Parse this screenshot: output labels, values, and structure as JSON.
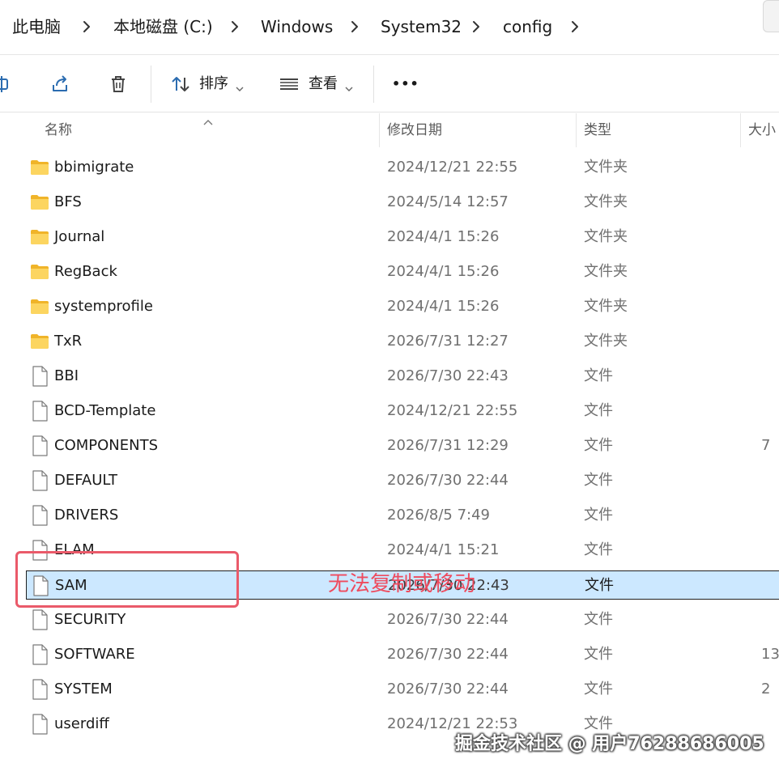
{
  "breadcrumb": {
    "items": [
      "此电脑",
      "本地磁盘 (C:)",
      "Windows",
      "System32",
      "config"
    ]
  },
  "toolbar": {
    "sort_label": "排序",
    "view_label": "查看",
    "more_label": "•••"
  },
  "columns": {
    "name": "名称",
    "modified": "修改日期",
    "type": "类型",
    "size": "大小"
  },
  "files": [
    {
      "name": "bbimigrate",
      "modified": "2024/12/21 22:55",
      "type": "文件夹",
      "size": "",
      "icon": "folder-icon"
    },
    {
      "name": "BFS",
      "modified": "2024/5/14 12:57",
      "type": "文件夹",
      "size": "",
      "icon": "folder-icon"
    },
    {
      "name": "Journal",
      "modified": "2024/4/1 15:26",
      "type": "文件夹",
      "size": "",
      "icon": "folder-icon"
    },
    {
      "name": "RegBack",
      "modified": "2024/4/1 15:26",
      "type": "文件夹",
      "size": "",
      "icon": "folder-icon"
    },
    {
      "name": "systemprofile",
      "modified": "2024/4/1 15:26",
      "type": "文件夹",
      "size": "",
      "icon": "folder-icon"
    },
    {
      "name": "TxR",
      "modified": "2026/7/31 12:27",
      "type": "文件夹",
      "size": "",
      "icon": "folder-icon"
    },
    {
      "name": "BBI",
      "modified": "2026/7/30 22:43",
      "type": "文件",
      "size": "",
      "icon": "file-icon"
    },
    {
      "name": "BCD-Template",
      "modified": "2024/12/21 22:55",
      "type": "文件",
      "size": "",
      "icon": "file-icon"
    },
    {
      "name": "COMPONENTS",
      "modified": "2026/7/31 12:29",
      "type": "文件",
      "size": "7",
      "icon": "file-icon"
    },
    {
      "name": "DEFAULT",
      "modified": "2026/7/30 22:44",
      "type": "文件",
      "size": "",
      "icon": "file-icon"
    },
    {
      "name": "DRIVERS",
      "modified": "2026/8/5 7:49",
      "type": "文件",
      "size": "",
      "icon": "file-icon"
    },
    {
      "name": "ELAM",
      "modified": "2024/4/1 15:21",
      "type": "文件",
      "size": "",
      "icon": "file-icon"
    },
    {
      "name": "SAM",
      "modified": "2026/7/30 22:43",
      "type": "文件",
      "size": "",
      "icon": "file-icon",
      "selected": true
    },
    {
      "name": "SECURITY",
      "modified": "2026/7/30 22:44",
      "type": "文件",
      "size": "",
      "icon": "file-icon"
    },
    {
      "name": "SOFTWARE",
      "modified": "2026/7/30 22:44",
      "type": "文件",
      "size": "13",
      "icon": "file-icon"
    },
    {
      "name": "SYSTEM",
      "modified": "2026/7/30 22:44",
      "type": "文件",
      "size": "2",
      "icon": "file-icon"
    },
    {
      "name": "userdiff",
      "modified": "2024/12/21 22:53",
      "type": "文件",
      "size": "",
      "icon": "file-icon"
    }
  ],
  "annotation": {
    "text": "无法复制或移动",
    "color": "#ee4b5e"
  },
  "watermark": "掘金技术社区 @ 用户76288686005",
  "colors": {
    "selection": "#cce8ff",
    "folder": "#f8c84a",
    "annotation_border": "#ea5a6a"
  }
}
